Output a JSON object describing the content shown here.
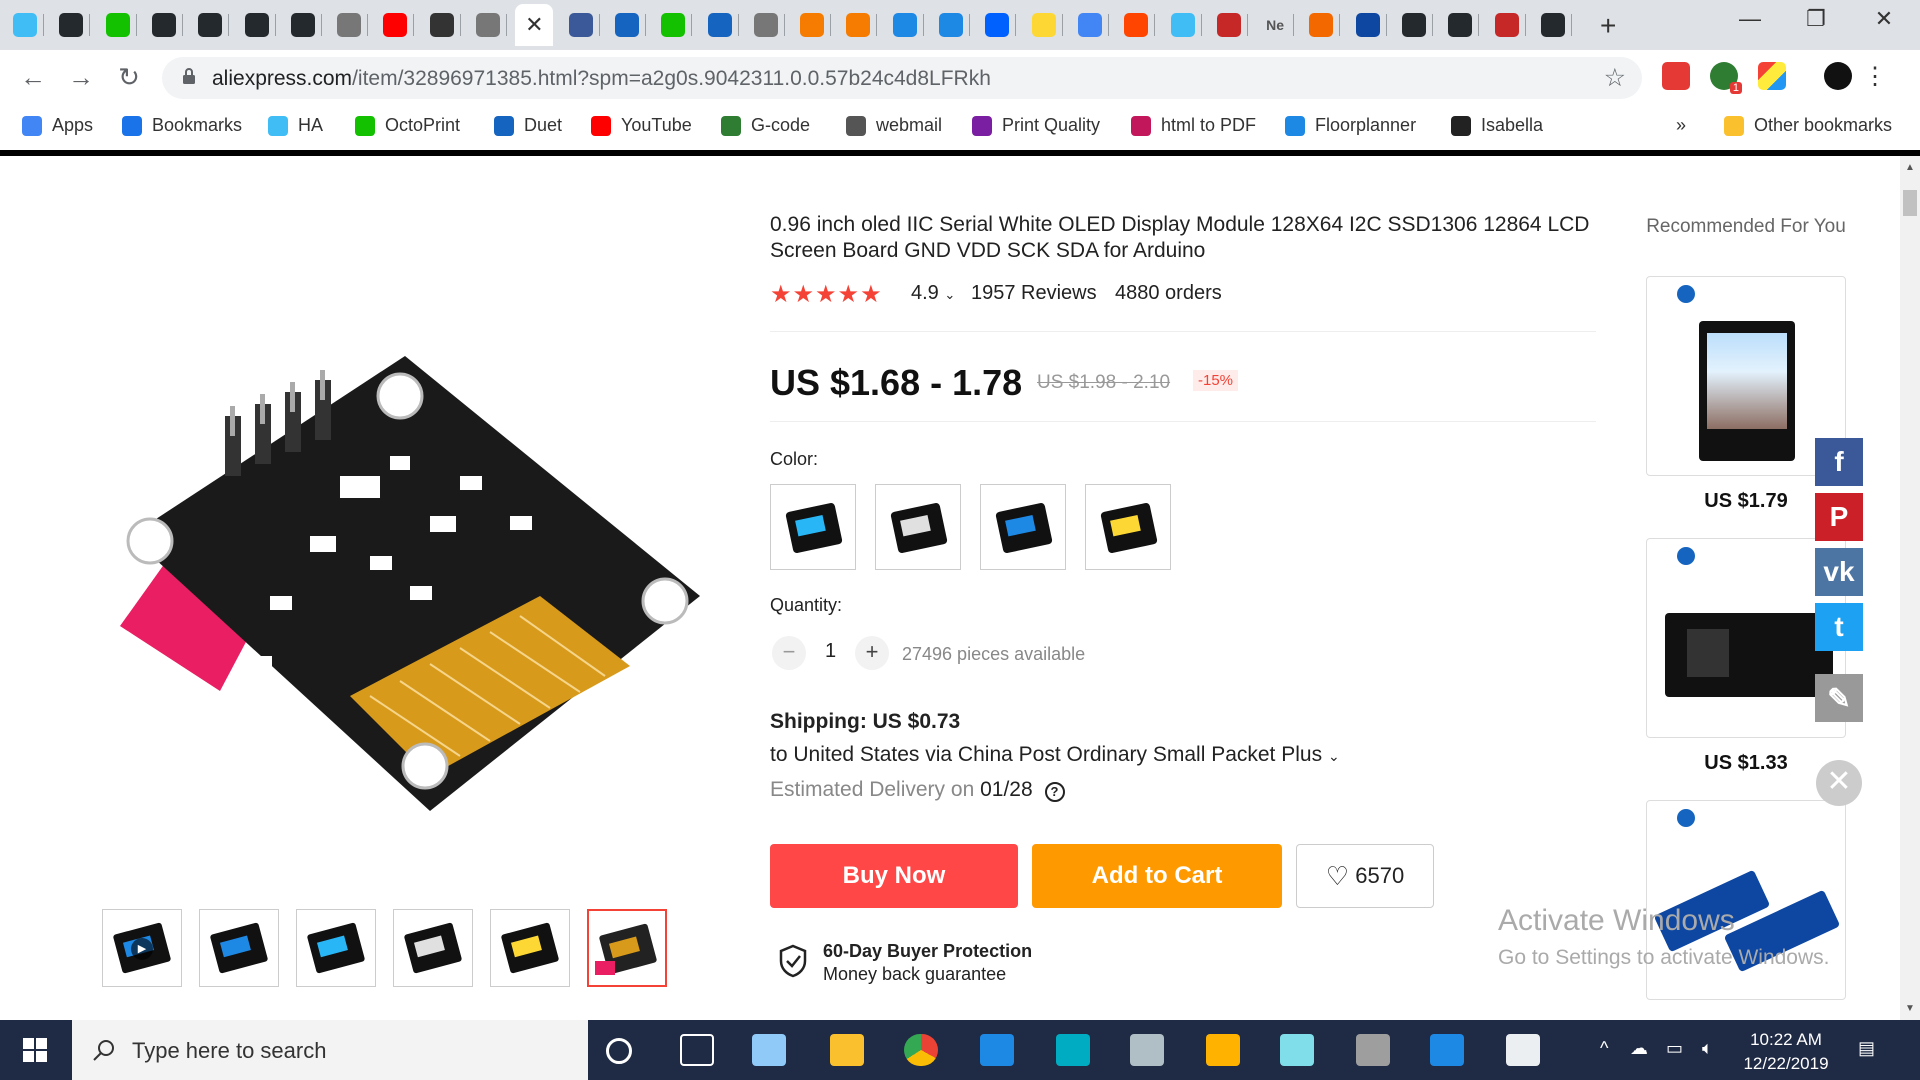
{
  "browser": {
    "tabs": [
      {
        "icon": "home-assistant-icon",
        "color": "#41bdf5"
      },
      {
        "icon": "github-icon",
        "color": "#24292e"
      },
      {
        "icon": "octoprint-icon",
        "color": "#13c100"
      },
      {
        "icon": "github-icon",
        "color": "#24292e"
      },
      {
        "icon": "github-icon",
        "color": "#24292e"
      },
      {
        "icon": "github-icon",
        "color": "#24292e"
      },
      {
        "icon": "github-icon",
        "color": "#24292e"
      },
      {
        "icon": "globe-icon",
        "color": "#777777"
      },
      {
        "icon": "youtube-icon",
        "color": "#ff0000"
      },
      {
        "icon": "store-icon",
        "color": "#333333"
      },
      {
        "icon": "globe-icon",
        "color": "#777777"
      },
      {
        "icon": "close-icon",
        "color": "#ffffff",
        "active": true
      },
      {
        "icon": "facebook-icon",
        "color": "#3b5998"
      },
      {
        "icon": "chart-icon",
        "color": "#1565c0"
      },
      {
        "icon": "octoprint-icon",
        "color": "#13c100"
      },
      {
        "icon": "duet-icon",
        "color": "#1565c0"
      },
      {
        "icon": "globe-icon",
        "color": "#777777"
      },
      {
        "icon": "headphones-icon",
        "color": "#f57c00"
      },
      {
        "icon": "app-icon",
        "color": "#f57c00"
      },
      {
        "icon": "app-icon",
        "color": "#1e88e5"
      },
      {
        "icon": "app-icon",
        "color": "#1e88e5"
      },
      {
        "icon": "dropbox-icon",
        "color": "#0061ff"
      },
      {
        "icon": "app-icon",
        "color": "#fdd835"
      },
      {
        "icon": "google-icon",
        "color": "#4285f4"
      },
      {
        "icon": "reddit-icon",
        "color": "#ff4500"
      },
      {
        "icon": "home-assistant-icon",
        "color": "#41bdf5"
      },
      {
        "icon": "app-icon",
        "color": "#c62828"
      },
      {
        "icon": "text-tab",
        "color": "#555555",
        "text": "Ne"
      },
      {
        "icon": "grafana-icon",
        "color": "#f46800"
      },
      {
        "icon": "pulse-icon",
        "color": "#0d47a1"
      },
      {
        "icon": "github-icon",
        "color": "#24292e"
      },
      {
        "icon": "github-icon",
        "color": "#24292e"
      },
      {
        "icon": "app-icon",
        "color": "#c62828"
      },
      {
        "icon": "github-icon",
        "color": "#24292e"
      }
    ],
    "url_host": "aliexpress.com",
    "url_path": "/item/32896971385.html?spm=a2g0s.9042311.0.0.57b24c4d8LFRkh",
    "extension_badge": "1",
    "bookmarks": [
      {
        "label": "Apps",
        "icon": "apps-grid-icon",
        "color": "#4285f4"
      },
      {
        "label": "Bookmarks",
        "icon": "star-icon",
        "color": "#1a73e8"
      },
      {
        "label": "HA",
        "icon": "home-assistant-icon",
        "color": "#41bdf5"
      },
      {
        "label": "OctoPrint",
        "icon": "octoprint-icon",
        "color": "#13c100"
      },
      {
        "label": "Duet",
        "icon": "duet-icon",
        "color": "#1565c0"
      },
      {
        "label": "YouTube",
        "icon": "youtube-icon",
        "color": "#ff0000"
      },
      {
        "label": "G-code",
        "icon": "gcode-icon",
        "color": "#2e7d32"
      },
      {
        "label": "webmail",
        "icon": "document-icon",
        "color": "#555555"
      },
      {
        "label": "Print Quality",
        "icon": "palette-icon",
        "color": "#7b1fa2"
      },
      {
        "label": "html to PDF",
        "icon": "pdf-icon",
        "color": "#c2185b"
      },
      {
        "label": "Floorplanner",
        "icon": "floorplanner-icon",
        "color": "#1e88e5"
      },
      {
        "label": "Isabella",
        "icon": "graduation-cap-icon",
        "color": "#222222"
      }
    ],
    "more_bookmarks": "»",
    "other_bookmarks": "Other bookmarks"
  },
  "product": {
    "title": "0.96 inch oled IIC Serial White OLED Display Module 128X64 I2C SSD1306 12864 LCD Screen Board GND VDD SCK SDA for Arduino",
    "stars": "★★★★★",
    "rating": "4.9",
    "reviews": "1957 Reviews",
    "orders": "4880 orders",
    "price": "US $1.68 - 1.78",
    "old_price": "US $1.98 - 2.10",
    "discount": "-15%",
    "color_label": "Color:",
    "colors": [
      {
        "name": "blue-yellow",
        "screen": "#29b6f6"
      },
      {
        "name": "white",
        "screen": "#e0e0e0"
      },
      {
        "name": "blue",
        "screen": "#1e88e5"
      },
      {
        "name": "yellow",
        "screen": "#fdd835"
      }
    ],
    "quantity_label": "Quantity:",
    "quantity": "1",
    "minus": "−",
    "plus": "+",
    "available": "27496 pieces available",
    "shipping_title": "Shipping: US $0.73",
    "shipping_route": "to United States via China Post Ordinary Small Packet Plus",
    "delivery_prefix": "Estimated Delivery on",
    "delivery_date": "01/28",
    "buy_now": "Buy Now",
    "add_to_cart": "Add to Cart",
    "wishlist_count": "6570",
    "protection_title": "60-Day Buyer Protection",
    "protection_sub": "Money back guarantee",
    "accent_red": "#ff4747",
    "accent_orange": "#ff9900"
  },
  "recommended": {
    "title": "Recommended For You",
    "items": [
      {
        "price": "US $1.79"
      },
      {
        "price": "US $1.33"
      },
      {
        "price": ""
      }
    ]
  },
  "social": [
    {
      "icon": "facebook-icon",
      "color": "#3b5998",
      "glyph": "f"
    },
    {
      "icon": "pinterest-icon",
      "color": "#cb2027",
      "glyph": "P"
    },
    {
      "icon": "vk-icon",
      "color": "#4c75a3",
      "glyph": "vk"
    },
    {
      "icon": "twitter-icon",
      "color": "#1da1f2",
      "glyph": "t"
    },
    {
      "icon": "edit-icon",
      "color": "#999999",
      "glyph": "✎"
    }
  ],
  "watermark": {
    "line1": "Activate Windows",
    "line2": "Go to Settings to activate Windows."
  },
  "taskbar": {
    "search_placeholder": "Type here to search",
    "time": "10:22 AM",
    "date": "12/22/2019"
  }
}
